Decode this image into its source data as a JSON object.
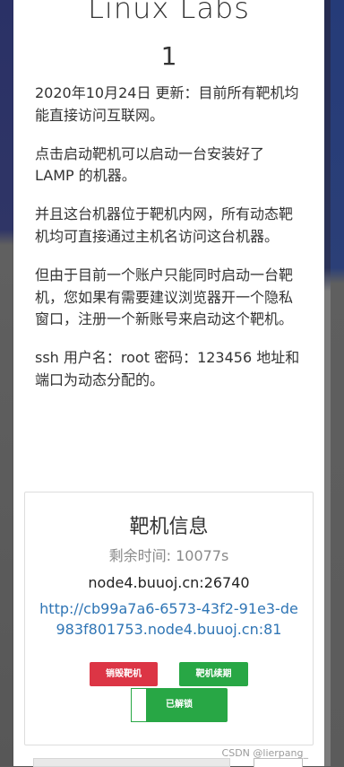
{
  "modal": {
    "title": "Linux Labs",
    "subtitle": "1",
    "paragraphs": [
      "2020年10月24日 更新：目前所有靶机均能直接访问互联网。",
      "点击启动靶机可以启动一台安装好了 LAMP 的机器。",
      "并且这台机器位于靶机内网，所有动态靶机均可直接通过主机名访问这台机器。",
      "但由于目前一个账户只能同时启动一台靶机，您如果有需要建议浏览器开一个隐私窗口，注册一个新账号来启动这个靶机。",
      "ssh 用户名：root 密码：123456 地址和端口为动态分配的。"
    ]
  },
  "card": {
    "title": "靶机信息",
    "remaining": "剩余时间: 10077s",
    "host": "node4.buuoj.cn:26740",
    "url": "http://cb99a7a6-6573-43f2-91e3-de983f801753.node4.buuoj.cn:81"
  },
  "buttons": {
    "destroy": "销毁靶机",
    "renew": "靶机续期",
    "locked": "已解锁"
  },
  "watermark": "CSDN @lierpang_"
}
